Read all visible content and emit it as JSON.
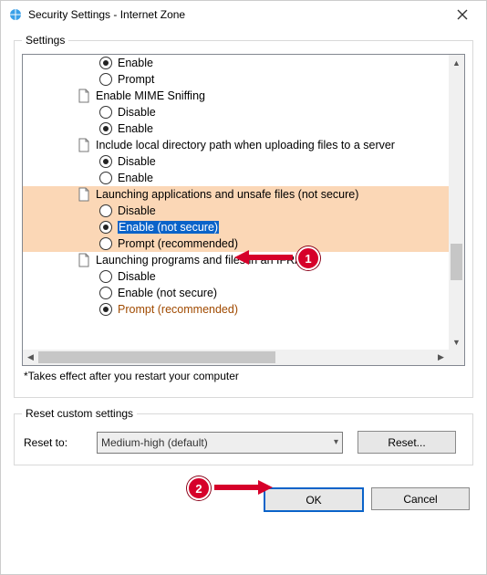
{
  "window": {
    "title": "Security Settings - Internet Zone"
  },
  "settings_legend": "Settings",
  "tree": {
    "partial_top": {
      "enable": "Enable",
      "prompt": "Prompt"
    },
    "mime": {
      "label": "Enable MIME Sniffing",
      "disable": "Disable",
      "enable": "Enable"
    },
    "localdir": {
      "label": "Include local directory path when uploading files to a server",
      "disable": "Disable",
      "enable": "Enable"
    },
    "launch_unsafe": {
      "label": "Launching applications and unsafe files (not secure)",
      "disable": "Disable",
      "enable": "Enable (not secure)",
      "prompt": "Prompt (recommended)"
    },
    "launch_iframe": {
      "label": "Launching programs and files in an IFRAME",
      "disable": "Disable",
      "enable": "Enable (not secure)",
      "prompt": "Prompt (recommended)"
    }
  },
  "note": "*Takes effect after you restart your computer",
  "reset": {
    "legend": "Reset custom settings",
    "label": "Reset to:",
    "combo": "Medium-high (default)",
    "button": "Reset..."
  },
  "buttons": {
    "ok": "OK",
    "cancel": "Cancel"
  },
  "callouts": {
    "one": "1",
    "two": "2"
  }
}
